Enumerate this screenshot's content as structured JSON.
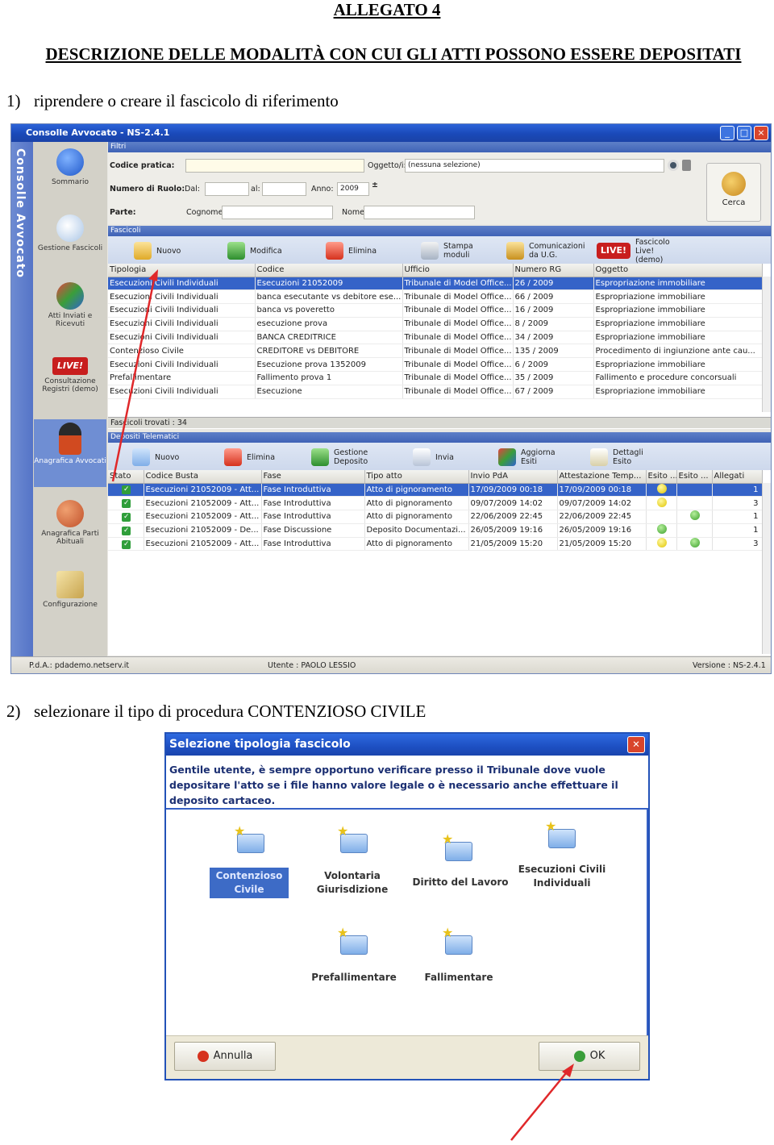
{
  "doc": {
    "allegato": "ALLEGATO 4",
    "heading": "DESCRIZIONE DELLE MODALITÀ CON CUI GLI ATTI POSSONO ESSERE DEPOSITATI",
    "step1_num": "1)",
    "step1_text": "riprendere o creare il fascicolo di riferimento",
    "step2_num": "2)",
    "step2_text": "selezionare il tipo di procedura CONTENZIOSO CIVILE"
  },
  "app": {
    "title": "Consolle Avvocato - NS-2.4.1",
    "brand": "Consolle Avvocato",
    "nav": [
      "Sommario",
      "Gestione Fascicoli",
      "Atti Inviati e Ricevuti",
      "Consultazione Registri (demo)",
      "Anagrafica Avvocati",
      "Anagrafica Parti Abituali",
      "Configurazione"
    ],
    "live_badge": "LIVE!",
    "filters": {
      "header": "Filtri",
      "codice_pratica": "Codice pratica:",
      "oggetto": "Oggetto/i:",
      "oggetto_value": "(nessuna selezione)",
      "numero_ruolo": "Numero di Ruolo:",
      "dal": "Dal:",
      "al": "al:",
      "anno": "Anno:",
      "anno_value": "2009",
      "parte": "Parte:",
      "cognome": "Cognome",
      "nome": "Nome",
      "cerca": "Cerca"
    },
    "fascicoli": {
      "header": "Fascicoli",
      "toolbar": [
        "Nuovo",
        "Modifica",
        "Elimina",
        "Stampa moduli",
        "Comunicazioni da U.G.",
        "Fascicolo Live! (demo)"
      ],
      "columns": [
        "Tipologia",
        "Codice",
        "Ufficio",
        "Numero RG",
        "Oggetto"
      ],
      "rows": [
        [
          "Esecuzioni Civili Individuali",
          "Esecuzioni 21052009",
          "Tribunale di Model Office...",
          "26 / 2009",
          "Espropriazione immobiliare"
        ],
        [
          "Esecuzioni Civili Individuali",
          "banca esecutante vs debitore ese...",
          "Tribunale di Model Office...",
          "66 / 2009",
          "Espropriazione immobiliare"
        ],
        [
          "Esecuzioni Civili Individuali",
          "banca vs poveretto",
          "Tribunale di Model Office...",
          "16 / 2009",
          "Espropriazione immobiliare"
        ],
        [
          "Esecuzioni Civili Individuali",
          "esecuzione prova",
          "Tribunale di Model Office...",
          "8 / 2009",
          "Espropriazione immobiliare"
        ],
        [
          "Esecuzioni Civili Individuali",
          "BANCA CREDITRICE",
          "Tribunale di Model Office...",
          "34 / 2009",
          "Espropriazione immobiliare"
        ],
        [
          "Contenzioso Civile",
          "CREDITORE vs DEBITORE",
          "Tribunale di Model Office...",
          "135 / 2009",
          "Procedimento di ingiunzione ante cau..."
        ],
        [
          "Esecuzioni Civili Individuali",
          "Esecuzione prova 1352009",
          "Tribunale di Model Office...",
          "6 / 2009",
          "Espropriazione immobiliare"
        ],
        [
          "Prefallimentare",
          "Fallimento prova 1",
          "Tribunale di Model Office...",
          "35 / 2009",
          "Fallimento e procedure concorsuali"
        ],
        [
          "Esecuzioni Civili Individuali",
          "Esecuzione",
          "Tribunale di Model Office...",
          "67 / 2009",
          "Espropriazione immobiliare"
        ]
      ],
      "count": "Fascicoli trovati : 34"
    },
    "depositi": {
      "header": "Depositi Telematici",
      "toolbar": [
        "Nuovo",
        "Elimina",
        "Gestione Deposito",
        "Invia",
        "Aggiorna Esiti",
        "Dettagli Esito"
      ],
      "columns": [
        "Stato",
        "Codice Busta",
        "Fase",
        "Tipo atto",
        "Invio PdA",
        "Attestazione Temp...",
        "Esito ...",
        "Esito ...",
        "Allegati"
      ],
      "rows": [
        {
          "codice": "Esecuzioni 21052009 - Att...",
          "fase": "Fase Introduttiva",
          "tipo": "Atto di pignoramento",
          "invio": "17/09/2009 00:18",
          "attest": "17/09/2009 00:18",
          "e1": "y",
          "e2": "",
          "allegati": "1"
        },
        {
          "codice": "Esecuzioni 21052009 - Att...",
          "fase": "Fase Introduttiva",
          "tipo": "Atto di pignoramento",
          "invio": "09/07/2009 14:02",
          "attest": "09/07/2009 14:02",
          "e1": "y",
          "e2": "",
          "allegati": "3"
        },
        {
          "codice": "Esecuzioni 21052009 - Att...",
          "fase": "Fase Introduttiva",
          "tipo": "Atto di pignoramento",
          "invio": "22/06/2009 22:45",
          "attest": "22/06/2009 22:45",
          "e1": "",
          "e2": "g",
          "allegati": "1"
        },
        {
          "codice": "Esecuzioni 21052009 - De...",
          "fase": "Fase Discussione",
          "tipo": "Deposito Documentazi...",
          "invio": "26/05/2009 19:16",
          "attest": "26/05/2009 19:16",
          "e1": "g",
          "e2": "",
          "allegati": "1"
        },
        {
          "codice": "Esecuzioni 21052009 - Att...",
          "fase": "Fase Introduttiva",
          "tipo": "Atto di pignoramento",
          "invio": "21/05/2009 15:20",
          "attest": "21/05/2009 15:20",
          "e1": "y",
          "e2": "g",
          "allegati": "3"
        }
      ]
    },
    "status": {
      "pda": "P.d.A.: pdademo.netserv.it",
      "utente": "Utente : PAOLO LESSIO",
      "versione": "Versione : NS-2.4.1"
    }
  },
  "dialog": {
    "title": "Selezione tipologia fascicolo",
    "message": "Gentile utente, è sempre opportuno verificare presso il Tribunale dove vuole depositare l'atto se i file hanno valore legale o è necessario anche effettuare il deposito cartaceo.",
    "options": [
      "Contenzioso Civile",
      "Volontaria Giurisdizione",
      "Diritto del Lavoro",
      "Esecuzioni Civili Individuali",
      "Prefallimentare",
      "Fallimentare"
    ],
    "cancel": "Annulla",
    "ok": "OK"
  },
  "colors": {
    "accent": "#3563c8",
    "arrow": "#e0282a",
    "titlebar": "#1d4fc2"
  }
}
